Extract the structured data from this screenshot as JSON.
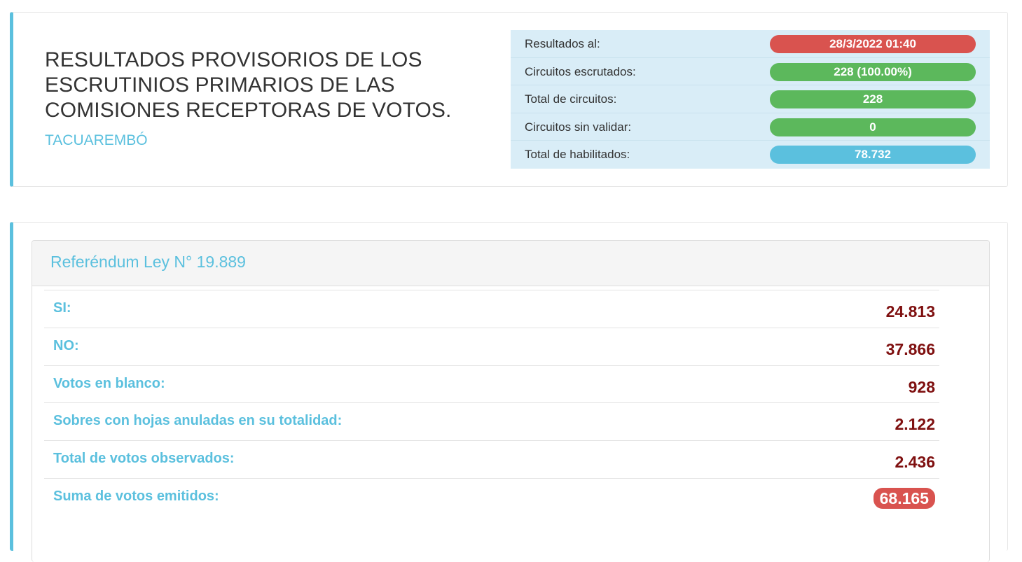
{
  "header": {
    "title": "RESULTADOS PROVISORIOS DE LOS ESCRUTINIOS PRIMARIOS DE LAS COMISIONES RECEPTORAS DE VOTOS.",
    "department": "TACUAREMBÓ"
  },
  "summary": [
    {
      "label": "Resultados al:",
      "value": "28/3/2022 01:40",
      "color": "#d9534f"
    },
    {
      "label": "Circuitos escrutados:",
      "value": "228 (100.00%)",
      "color": "#5cb85c"
    },
    {
      "label": "Total de circuitos:",
      "value": "228",
      "color": "#5cb85c"
    },
    {
      "label": "Circuitos sin validar:",
      "value": "0",
      "color": "#5cb85c"
    },
    {
      "label": "Total de habilitados:",
      "value": "78.732",
      "color": "#5bc0de"
    }
  ],
  "panel": {
    "title": "Referéndum Ley N° 19.889",
    "results": [
      {
        "label": "SI:",
        "value": "24.813"
      },
      {
        "label": "NO:",
        "value": "37.866"
      },
      {
        "label": "Votos en blanco:",
        "value": "928"
      },
      {
        "label": "Sobres con hojas anuladas en su totalidad:",
        "value": "2.122"
      },
      {
        "label": "Total de votos observados:",
        "value": "2.436"
      },
      {
        "label": "Suma de votos emitidos:",
        "value": "68.165",
        "badge_color": "#d9534f"
      }
    ]
  }
}
